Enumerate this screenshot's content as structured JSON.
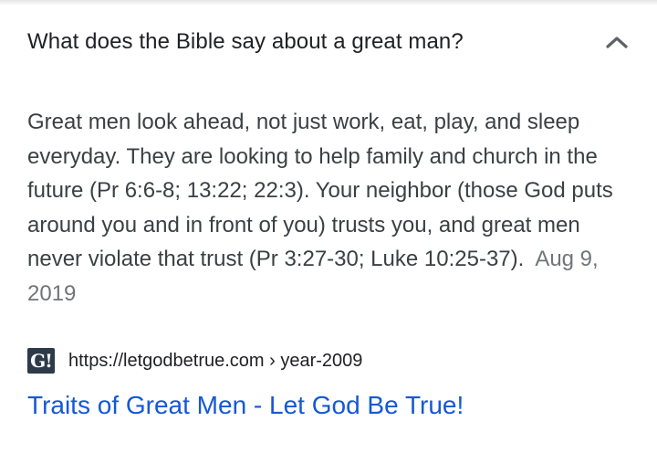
{
  "question": {
    "text": "What does the Bible say about a great man?",
    "chevron_icon": "chevron-up-icon"
  },
  "answer": {
    "body": "Great men look ahead, not just work, eat, play, and sleep everyday. They are looking to help family and church in the future (Pr 6:6-8; 13:22; 22:3). Your neighbor (those God puts around you and in front of you) trusts you, and great men never violate that trust (Pr 3:27-30; Luke 10:25-37).",
    "date": "Aug 9, 2019"
  },
  "source": {
    "favicon_text": "G!",
    "url": "https://letgodbetrue.com › year-2009"
  },
  "result": {
    "title": "Traits of Great Men - Let God Be True!"
  },
  "colors": {
    "link": "#1558d6",
    "text": "#202124",
    "muted": "#70757a"
  }
}
